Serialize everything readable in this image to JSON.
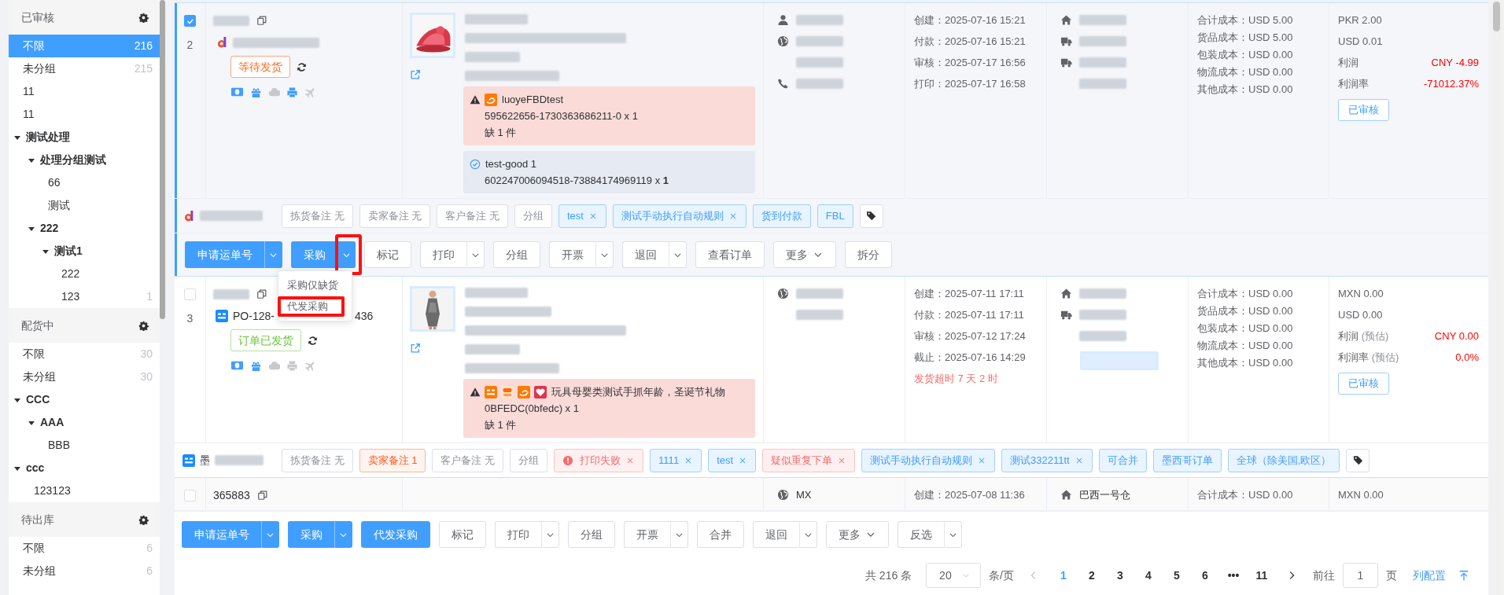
{
  "sidebar": [
    {
      "title": "已审核",
      "items": [
        {
          "label": "不限",
          "count": "216",
          "selected": true
        },
        {
          "label": "未分组",
          "count": "215",
          "selected": false
        },
        {
          "label": "11",
          "selected": false
        },
        {
          "label": "11",
          "selected": false
        },
        {
          "label": "测试处理",
          "selected": false,
          "expanded": true,
          "children": [
            {
              "label": "处理分组测试",
              "selected": false,
              "expanded": true,
              "children": [
                {
                  "label": "66",
                  "selected": false
                },
                {
                  "label": "测试",
                  "selected": false
                }
              ]
            },
            {
              "label": "222",
              "selected": false,
              "expanded": true,
              "children": [
                {
                  "label": "测试1",
                  "selected": false,
                  "expanded": true,
                  "children": [
                    {
                      "label": "222",
                      "selected": false
                    },
                    {
                      "label": "123",
                      "count": "1",
                      "selected": false
                    }
                  ]
                }
              ]
            }
          ]
        }
      ]
    },
    {
      "title": "配货中",
      "items": [
        {
          "label": "不限",
          "count": "30",
          "selected": false
        },
        {
          "label": "未分组",
          "count": "30",
          "selected": false
        },
        {
          "label": "CCC",
          "selected": false,
          "expanded": true,
          "children": [
            {
              "label": "AAA",
              "selected": false,
              "expanded": true,
              "children": [
                {
                  "label": "BBB",
                  "selected": false
                }
              ]
            }
          ]
        },
        {
          "label": "ccc",
          "selected": false,
          "expanded": true,
          "children": [
            {
              "label": "123123",
              "selected": false
            }
          ]
        }
      ]
    },
    {
      "title": "待出库",
      "items": [
        {
          "label": "不限",
          "count": "6",
          "selected": false
        },
        {
          "label": "未分组",
          "count": "6",
          "selected": false
        }
      ]
    }
  ],
  "orders": [
    {
      "selected": true,
      "index": "2",
      "status": {
        "label": "等待发货",
        "kind": "pending"
      },
      "tools": [
        {
          "enabled": true
        },
        {
          "enabled": true
        },
        {
          "enabled": false
        },
        {
          "enabled": true
        },
        {
          "enabled": false
        }
      ],
      "product": {
        "kind": "picture"
      },
      "alerts": [
        {
          "kind": "shortage",
          "title": "luoyeFBDtest",
          "lines": [
            "595622656-1730363686211-0 x 1",
            "缺 1 件"
          ]
        },
        {
          "kind": "matched",
          "title": "test-good 1",
          "lines": [
            "602247006094518-73884174969119 x **1**"
          ]
        }
      ],
      "buyer": [
        {
          "kind": "name"
        },
        {
          "kind": "country"
        },
        {
          "kind": "address"
        },
        {
          "kind": "phone"
        }
      ],
      "times": [
        {
          "text": "创建：2025-07-16 15:21",
          "overdue": false
        },
        {
          "text": "付款：2025-07-16 15:21",
          "overdue": false
        },
        {
          "text": "审核：2025-07-17 16:56",
          "overdue": false
        },
        {
          "text": "打印：2025-07-17 16:58",
          "overdue": false
        }
      ],
      "warehouse": [
        {
          "kind": "warehouse"
        },
        {
          "kind": "carrier"
        },
        {
          "kind": "carrier"
        },
        {
          "kind": "service"
        }
      ],
      "costs": [
        "合计成本：USD 5.00",
        "货品成本：USD 5.00",
        "包装成本：USD 0.00",
        "物流成本：USD 0.00",
        "其他成本：USD 0.00"
      ],
      "amounts": [
        "PKR 2.00",
        "USD 0.01"
      ],
      "profit": {
        "label": "利润",
        "value": "CNY -4.99"
      },
      "rate": {
        "label": "利润率",
        "value": "-71012.37%"
      },
      "review": "已审核",
      "notes": [
        {
          "label": "拣货备注 无",
          "kind": "note"
        },
        {
          "label": "卖家备注 无",
          "kind": "note"
        },
        {
          "label": "客户备注 无",
          "kind": "note"
        },
        {
          "label": "分组",
          "kind": "note"
        }
      ],
      "tags": [
        {
          "label": "test",
          "kind": "tag",
          "closable": true
        },
        {
          "label": "测试手动执行自动规则",
          "kind": "tag",
          "closable": true
        },
        {
          "label": "货到付款",
          "kind": "tag",
          "closable": false
        },
        {
          "label": "FBL",
          "kind": "tag",
          "closable": false
        }
      ],
      "actions": [
        {
          "label": "申请运单号",
          "kind": "primary-split",
          "annotated": false
        },
        {
          "label": "采购",
          "kind": "primary-split",
          "annotated": true,
          "open_menu": [
            {
              "label": "采购仅缺货",
              "annotated": false
            },
            {
              "label": "代发采购",
              "annotated": true
            }
          ]
        },
        {
          "label": "标记",
          "kind": "plain",
          "annotated": false
        },
        {
          "label": "打印",
          "kind": "split",
          "annotated": false
        },
        {
          "label": "分组",
          "kind": "plain",
          "annotated": false
        },
        {
          "label": "开票",
          "kind": "split",
          "annotated": false
        },
        {
          "label": "退回",
          "kind": "split",
          "annotated": false
        },
        {
          "label": "查看订单",
          "kind": "plain",
          "annotated": false
        },
        {
          "label": "更多",
          "kind": "dropdown",
          "annotated": false
        },
        {
          "label": "拆分",
          "kind": "plain",
          "annotated": false
        }
      ]
    },
    {
      "selected": false,
      "index": "3",
      "order_no": [
        "PO-128-",
        "436"
      ],
      "status": {
        "label": "订单已发货",
        "kind": "shipped"
      },
      "tools": [
        {
          "enabled": true
        },
        {
          "enabled": true
        },
        {
          "enabled": false
        },
        {
          "enabled": false
        },
        {
          "enabled": false
        }
      ],
      "product": {
        "kind": "picture"
      },
      "alerts": [
        {
          "kind": "shortage",
          "title": "玩具母婴类测试手抓年龄，圣诞节礼物",
          "lines": [
            "0BFEDC(0bfedc) x 1",
            "缺 1 件"
          ]
        }
      ],
      "buyer": [
        {
          "kind": "country"
        },
        {
          "kind": "address"
        }
      ],
      "times": [
        {
          "text": "创建：2025-07-11 17:11",
          "overdue": false
        },
        {
          "text": "付款：2025-07-11 17:11",
          "overdue": false
        },
        {
          "text": "审核：2025-07-12 17:24",
          "overdue": false
        },
        {
          "text": "截止：2025-07-16 14:29",
          "overdue": false
        },
        {
          "text": "发货超时 7 天 2 时",
          "overdue": true
        }
      ],
      "warehouse": [
        {
          "kind": "warehouse"
        },
        {
          "kind": "carrier"
        },
        {
          "kind": "service"
        },
        {
          "kind": "tracking"
        }
      ],
      "costs": [
        "合计成本：USD 0.00",
        "货品成本：USD 0.00",
        "包装成本：USD 0.00",
        "物流成本：USD 0.00",
        "其他成本：USD 0.00"
      ],
      "amounts": [
        "MXN 0.00",
        "USD 0.00"
      ],
      "profit": {
        "label": "利润",
        "note": "(预估)",
        "value": "CNY 0.00"
      },
      "rate": {
        "label": "利润率",
        "note": "(预估)",
        "value": "0.0%"
      },
      "review": "已审核",
      "shop_prefix": "墨",
      "notes": [
        {
          "label": "拣货备注 无",
          "kind": "note"
        },
        {
          "label": "卖家备注 1",
          "kind": "note_alert"
        },
        {
          "label": "客户备注 无",
          "kind": "note"
        },
        {
          "label": "分组",
          "kind": "note"
        }
      ],
      "tags": [
        {
          "label": "打印失败",
          "kind": "error",
          "closable": true
        },
        {
          "label": "1111",
          "kind": "tag",
          "closable": true
        },
        {
          "label": "test",
          "kind": "tag",
          "closable": true
        },
        {
          "label": "疑似重复下单",
          "kind": "alert",
          "closable": true
        },
        {
          "label": "测试手动执行自动规则",
          "kind": "tag",
          "closable": true
        },
        {
          "label": "测试332211tt",
          "kind": "tag",
          "closable": true
        },
        {
          "label": "可合并",
          "kind": "tag",
          "closable": false
        },
        {
          "label": "墨西哥订单",
          "kind": "tag",
          "closable": false
        },
        {
          "label": "全球（除美国,欧区）",
          "kind": "tag",
          "closable": false
        }
      ]
    },
    {
      "selected": false,
      "order_id": "365883",
      "buyer": [
        {
          "kind": "country",
          "text": "MX"
        }
      ],
      "times": [
        {
          "text": "创建：2025-07-08 11:36",
          "overdue": false
        }
      ],
      "warehouse": [
        {
          "kind": "warehouse",
          "text": "巴西一号仓"
        }
      ],
      "costs": [
        "合计成本：USD 0.00"
      ],
      "amounts": [
        "MXN 0.00"
      ]
    }
  ],
  "bulk_actions": [
    {
      "label": "申请运单号",
      "kind": "primary-split"
    },
    {
      "label": "采购",
      "kind": "primary-split"
    },
    {
      "label": "代发采购",
      "kind": "primary"
    },
    {
      "label": "标记",
      "kind": "plain"
    },
    {
      "label": "打印",
      "kind": "split"
    },
    {
      "label": "分组",
      "kind": "plain"
    },
    {
      "label": "开票",
      "kind": "split"
    },
    {
      "label": "合并",
      "kind": "plain"
    },
    {
      "label": "退回",
      "kind": "split"
    },
    {
      "label": "更多",
      "kind": "dropdown"
    },
    {
      "label": "反选",
      "kind": "split"
    }
  ],
  "pagination": {
    "total": "共 216 条",
    "page_size": "20",
    "per_page": "条/页",
    "pages": [
      {
        "label": "1",
        "selected": true
      },
      {
        "label": "2",
        "selected": false
      },
      {
        "label": "3",
        "selected": false
      },
      {
        "label": "4",
        "selected": false
      },
      {
        "label": "5",
        "selected": false
      },
      {
        "label": "6",
        "selected": false
      },
      {
        "label": "•••",
        "selected": false
      },
      {
        "label": "11",
        "selected": false
      }
    ],
    "goto": "前往",
    "page_input": "1",
    "page_unit": "页",
    "columns_link": "列配置"
  }
}
